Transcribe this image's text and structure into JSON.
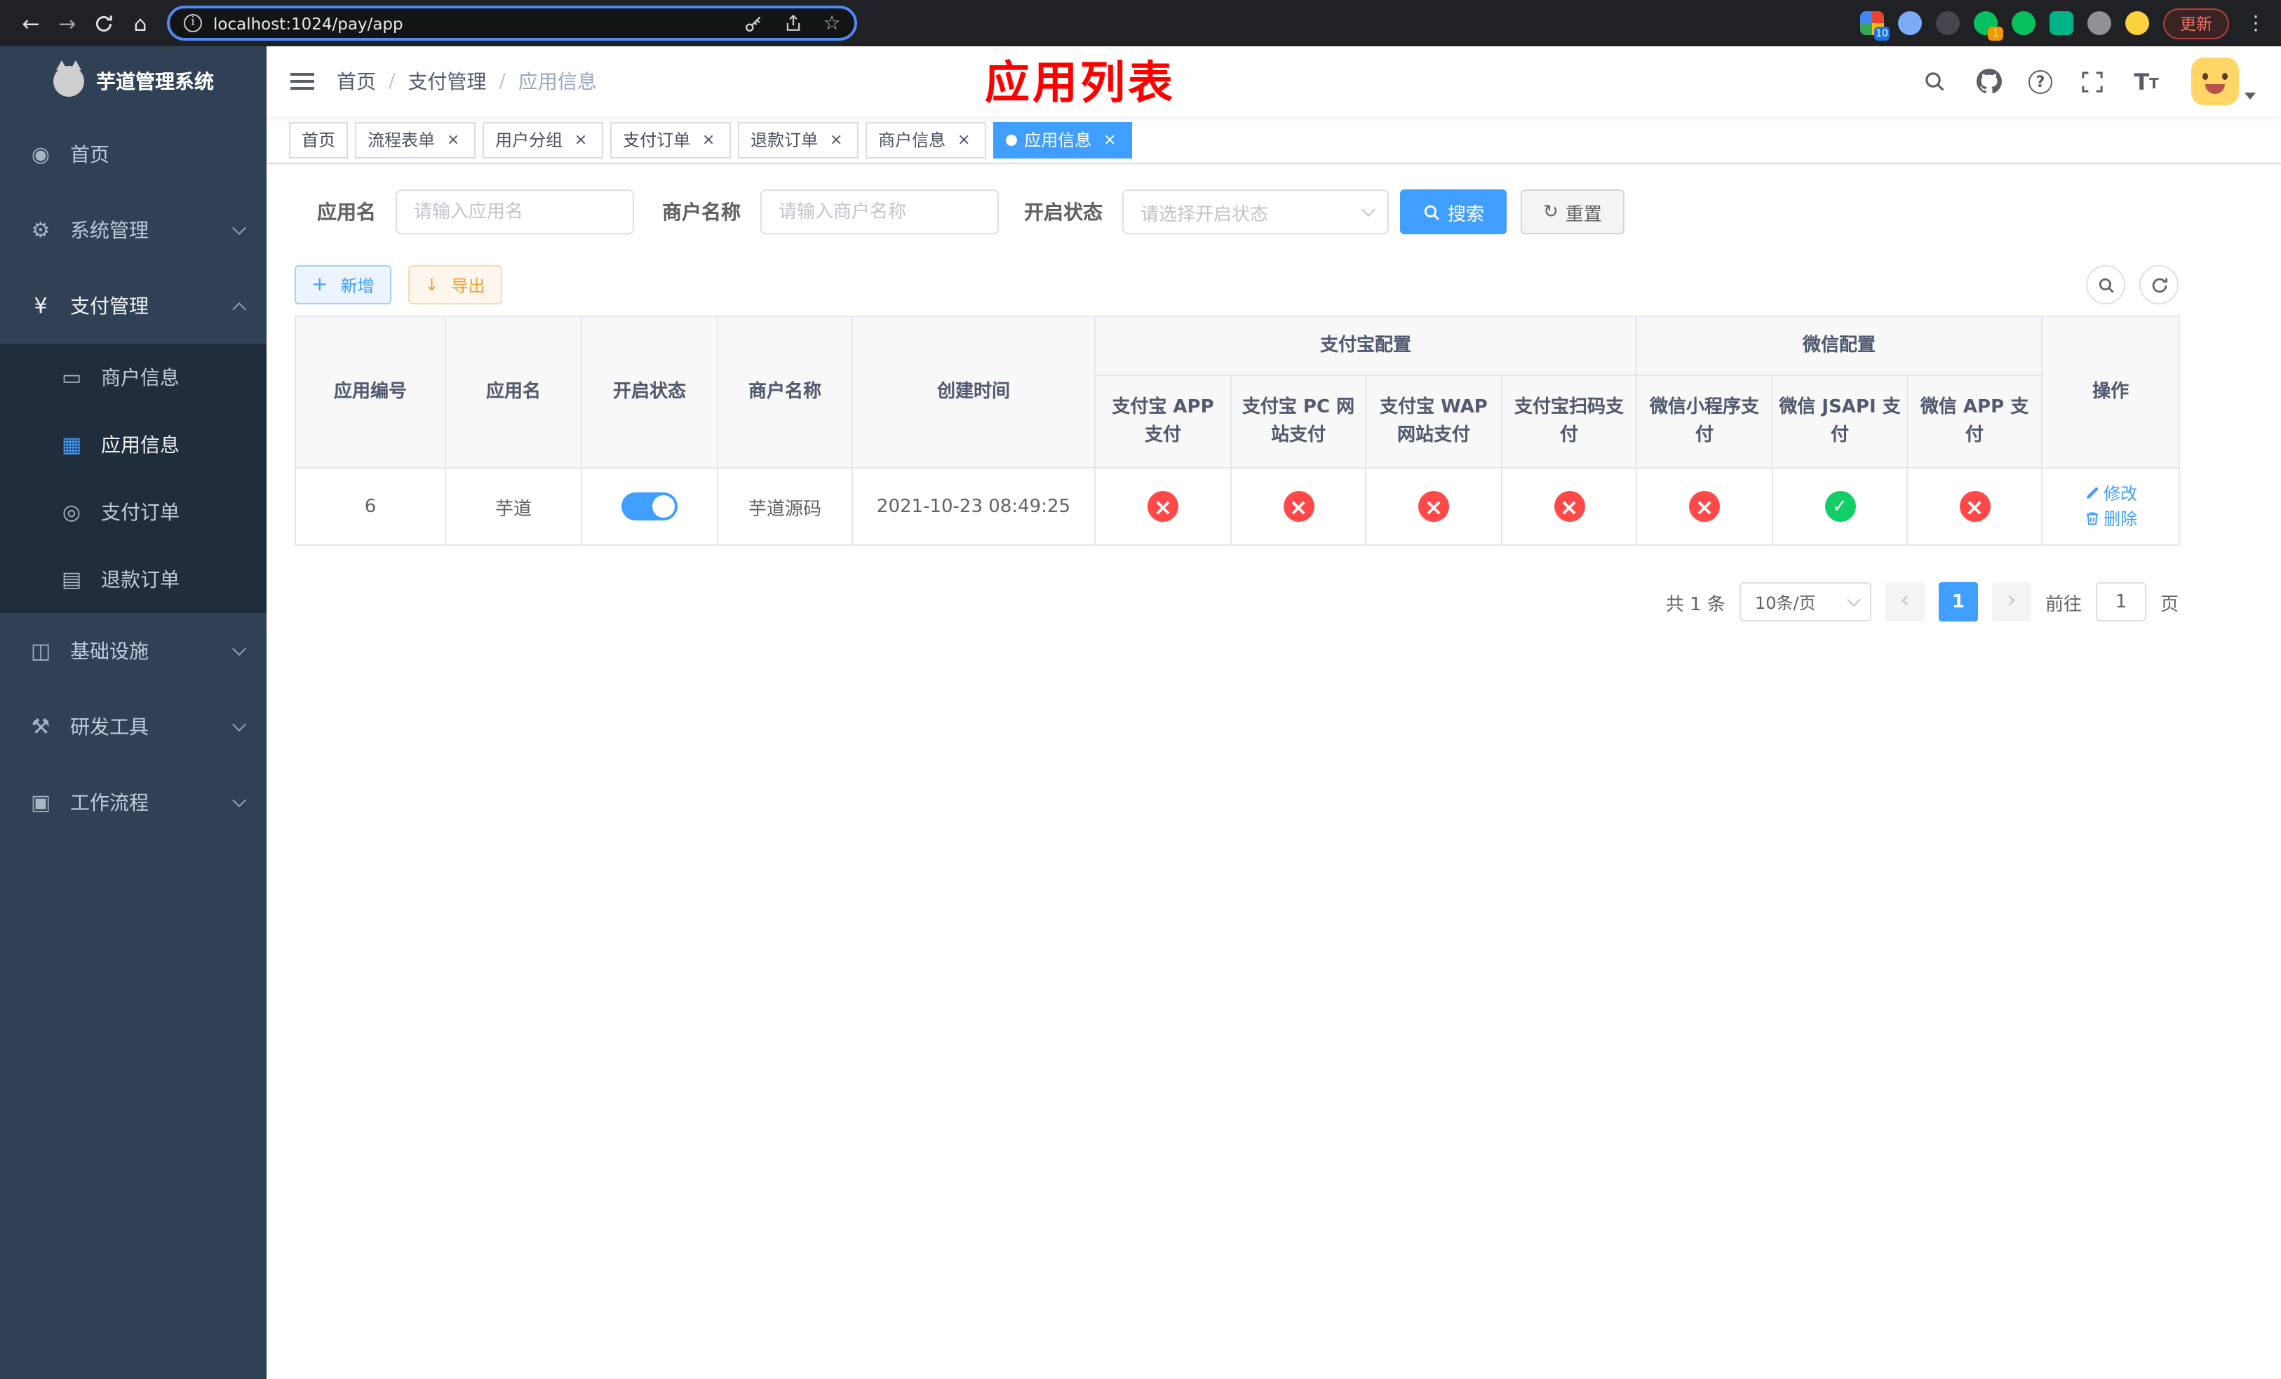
{
  "browser": {
    "url": "localhost:1024/pay/app",
    "update_button": "更新",
    "extension_badges": {
      "first": "10",
      "fourth": "1"
    }
  },
  "sidebar": {
    "title": "芋道管理系统",
    "menu": [
      {
        "label": "首页"
      },
      {
        "label": "系统管理"
      },
      {
        "label": "支付管理"
      },
      {
        "label": "商户信息"
      },
      {
        "label": "应用信息"
      },
      {
        "label": "支付订单"
      },
      {
        "label": "退款订单"
      },
      {
        "label": "基础设施"
      },
      {
        "label": "研发工具"
      },
      {
        "label": "工作流程"
      }
    ]
  },
  "navbar": {
    "breadcrumb": {
      "home": "首页",
      "section": "支付管理",
      "current": "应用信息"
    },
    "annotation": "应用列表",
    "annotation_color": "#ff0000"
  },
  "tabs": [
    {
      "label": "首页"
    },
    {
      "label": "流程表单"
    },
    {
      "label": "用户分组"
    },
    {
      "label": "支付订单"
    },
    {
      "label": "退款订单"
    },
    {
      "label": "商户信息"
    },
    {
      "label": "应用信息"
    }
  ],
  "filter": {
    "app_name_label": "应用名",
    "app_name_placeholder": "请输入应用名",
    "merchant_label": "商户名称",
    "merchant_placeholder": "请输入商户名称",
    "status_label": "开启状态",
    "status_placeholder": "请选择开启状态",
    "search_button": "搜索",
    "reset_button": "重置"
  },
  "toolbar": {
    "add_button": "新增",
    "export_button": "导出"
  },
  "table": {
    "headers": {
      "app_id": "应用编号",
      "app_name": "应用名",
      "status": "开启状态",
      "merchant_name": "商户名称",
      "create_time": "创建时间",
      "alipay_group": "支付宝配置",
      "wechat_group": "微信配置",
      "alipay_app": "支付宝 APP 支付",
      "alipay_pc": "支付宝 PC 网站支付",
      "alipay_wap": "支付宝 WAP 网站支付",
      "alipay_qr": "支付宝扫码支付",
      "wechat_mini": "微信小程序支付",
      "wechat_jsapi": "微信 JSAPI 支付",
      "wechat_app": "微信 APP 支付",
      "actions": "操作"
    },
    "row": {
      "app_id": "6",
      "app_name": "芋道",
      "status": "on",
      "merchant_name": "芋道源码",
      "create_time": "2021-10-23 08:49:25",
      "alipay_app": "off",
      "alipay_pc": "off",
      "alipay_wap": "off",
      "alipay_qr": "off",
      "wechat_mini": "off",
      "wechat_jsapi": "on",
      "wechat_app": "off",
      "edit_link": "修改",
      "delete_link": "删除"
    },
    "status_colors": {
      "on": "#13ce66",
      "off": "#ff4949"
    }
  },
  "pagination": {
    "total": "共 1 条",
    "page_size": "10条/页",
    "page": "1",
    "goto_label": "前往",
    "goto_value": "1",
    "goto_unit": "页"
  },
  "colors": {
    "primary": "#409eff",
    "sidebar_bg": "#304156",
    "sidebar_submenu_bg": "#1f2d3d"
  }
}
